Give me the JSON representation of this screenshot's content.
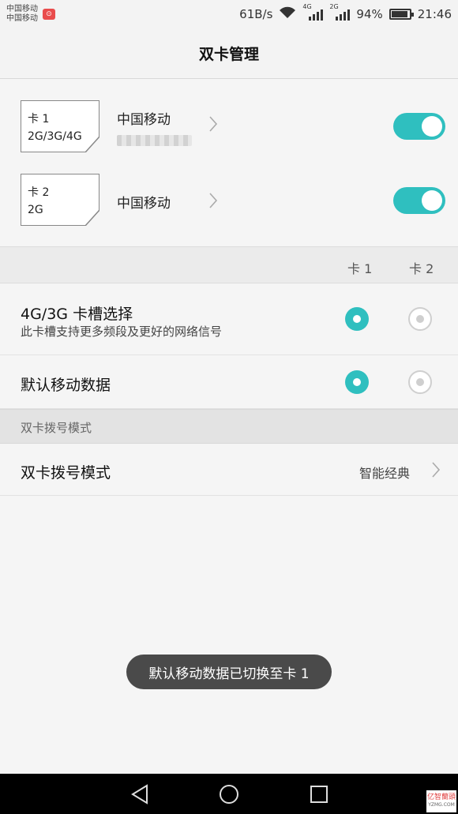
{
  "status_bar": {
    "carrier_1": "中国移动",
    "carrier_2": "中国移动",
    "net_speed": "61B/s",
    "sim1_network": "4G",
    "sim2_network": "2G",
    "battery": "94%",
    "battery_level": 0.94,
    "time": "21:46"
  },
  "header": {
    "title": "双卡管理"
  },
  "sims": [
    {
      "slot": "卡 1",
      "bands": "2G/3G/4G",
      "operator": "中国移动",
      "enabled": true
    },
    {
      "slot": "卡 2",
      "bands": "2G",
      "operator": "中国移动",
      "enabled": true
    }
  ],
  "columns": {
    "card1": "卡 1",
    "card2": "卡 2"
  },
  "options": [
    {
      "label": "4G/3G 卡槽选择",
      "sub": "此卡槽支持更多频段及更好的网络信号",
      "selected": "卡 1"
    },
    {
      "label": "默认移动数据",
      "selected": "卡 1"
    }
  ],
  "dial_section": {
    "header": "双卡拨号模式",
    "row_label": "双卡拨号模式",
    "row_value": "智能经典"
  },
  "toast": "默认移动数据已切换至卡 1",
  "watermark": {
    "line1": "亿智蘭頭",
    "line2": "YZMG.COM"
  },
  "colors": {
    "accent": "#2fbfbf",
    "toast_bg": "#4a4a4a"
  }
}
